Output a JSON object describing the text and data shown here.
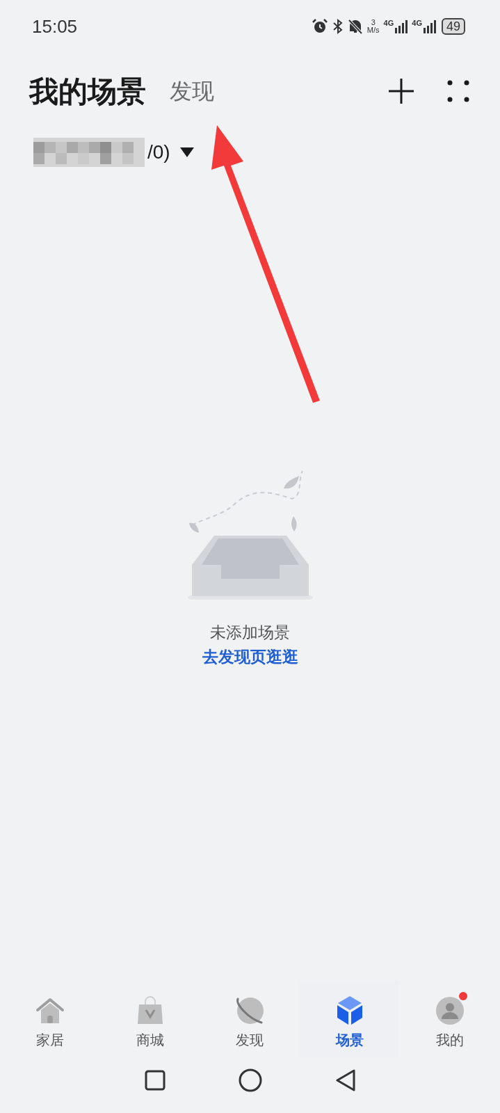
{
  "status_bar": {
    "time": "15:05",
    "speed_value": "3",
    "speed_unit": "M/s",
    "network_1": "4G",
    "network_2": "4G",
    "battery": "49"
  },
  "header": {
    "tabs": [
      {
        "label": "我的场景",
        "selected": true
      },
      {
        "label": "发现",
        "selected": false
      }
    ]
  },
  "home_selector": {
    "label": "/0)"
  },
  "empty_state": {
    "message": "未添加场景",
    "link": "去发现页逛逛"
  },
  "bottom_nav": [
    {
      "label": "家居",
      "kind": "home",
      "selected": false,
      "badge": false
    },
    {
      "label": "商城",
      "kind": "shop",
      "selected": false,
      "badge": false
    },
    {
      "label": "发现",
      "kind": "discover",
      "selected": false,
      "badge": false
    },
    {
      "label": "场景",
      "kind": "scene",
      "selected": true,
      "badge": false
    },
    {
      "label": "我的",
      "kind": "me",
      "selected": false,
      "badge": true
    }
  ]
}
